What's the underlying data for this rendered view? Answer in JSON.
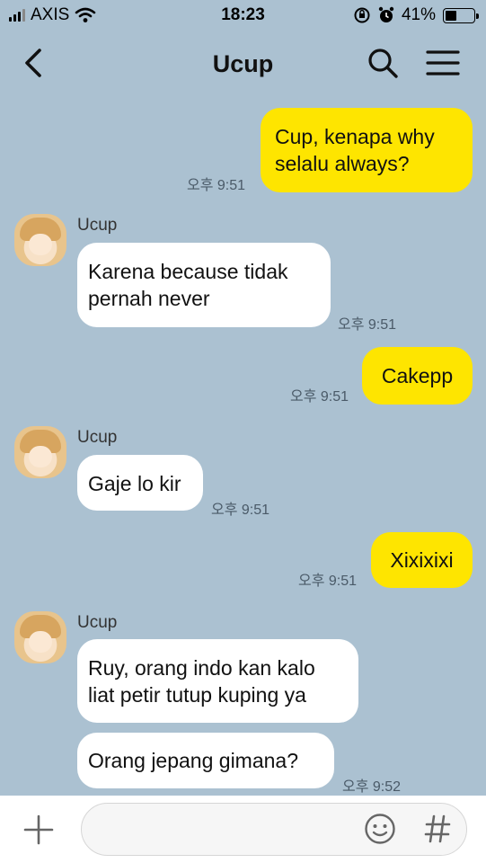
{
  "status_bar": {
    "carrier": "AXIS",
    "time": "18:23",
    "battery": "41%",
    "battery_level": 0.41
  },
  "header": {
    "title": "Ucup"
  },
  "messages": [
    {
      "from": "me",
      "text": "Cup, kenapa why\nselalu always?",
      "time": "오후 9:51"
    },
    {
      "from": "them",
      "sender": "Ucup",
      "text": "Karena because tidak\npernah never",
      "time": "오후 9:51"
    },
    {
      "from": "me",
      "text": "Cakepp",
      "time": "오후 9:51"
    },
    {
      "from": "them",
      "sender": "Ucup",
      "text": "Gaje lo kir",
      "time": "오후 9:51"
    },
    {
      "from": "me",
      "text": "Xixixixi",
      "time": "오후 9:51"
    },
    {
      "from": "them",
      "sender": "Ucup",
      "text": "Ruy, orang indo kan kalo\nliat petir tutup kuping ya",
      "time": ""
    },
    {
      "from": "them",
      "text": "Orang jepang gimana?",
      "time": "오후 9:52"
    }
  ],
  "colors": {
    "background": "#abc1d1",
    "my_bubble": "#fee500",
    "their_bubble": "#ffffff"
  },
  "icons": {
    "back": "chevron-left-icon",
    "search": "search-icon",
    "menu": "hamburger-menu-icon",
    "attach": "plus-icon",
    "emoji": "emoji-icon",
    "hashtag": "hashtag-icon"
  }
}
